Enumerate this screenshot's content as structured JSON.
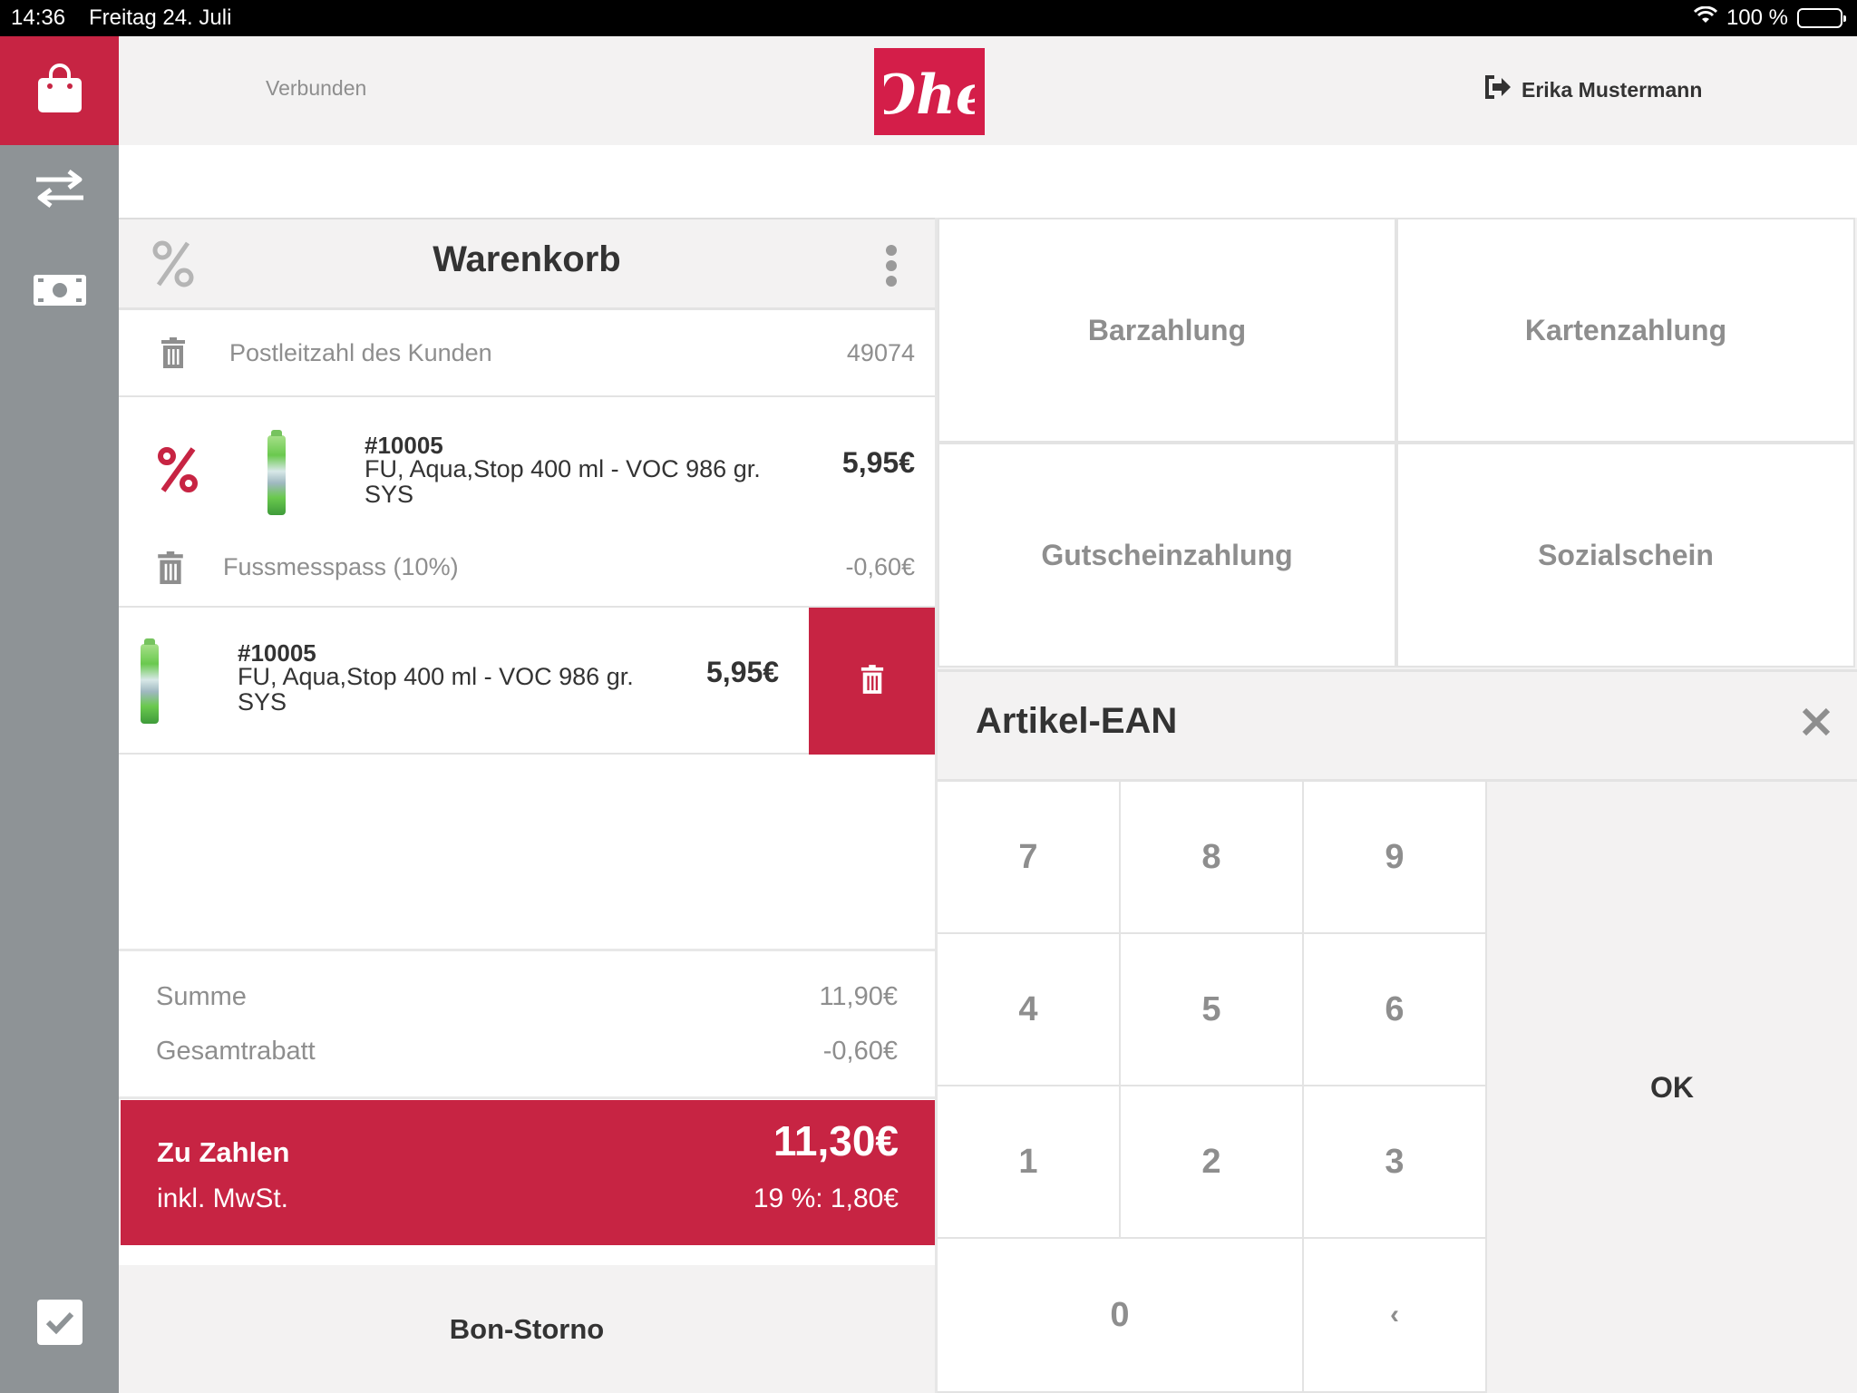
{
  "status": {
    "time": "14:36",
    "date": "Freitag 24. Juli",
    "battery": "100 %"
  },
  "sidebar": {
    "items": [
      {
        "name": "shop",
        "icon": "shopping-bag-icon"
      },
      {
        "name": "transfer",
        "icon": "arrows-exchange-icon"
      },
      {
        "name": "cash",
        "icon": "banknote-icon"
      },
      {
        "name": "confirm",
        "icon": "checkbox-icon"
      }
    ]
  },
  "header": {
    "connection": "Verbunden",
    "logo_text": "Ohe",
    "user": "Erika Mustermann"
  },
  "cart": {
    "title": "Warenkorb",
    "postal": {
      "label": "Postleitzahl des Kunden",
      "value": "49074"
    },
    "items": [
      {
        "number": "#10005",
        "name": "FU, Aqua,Stop 400 ml - VOC 986 gr. SYS",
        "price": "5,95€",
        "discount": {
          "label": "Fussmesspass (10%)",
          "value": "-0,60€"
        }
      },
      {
        "number": "#10005",
        "name": "FU, Aqua,Stop 400 ml - VOC 986 gr. SYS",
        "price": "5,95€"
      }
    ],
    "totals": {
      "sum_label": "Summe",
      "sum_value": "11,90€",
      "discount_label": "Gesamtrabatt",
      "discount_value": "-0,60€"
    },
    "pay": {
      "label": "Zu Zahlen",
      "value": "11,30€",
      "tax_label": "inkl. MwSt.",
      "tax_value": "19 %: 1,80€"
    },
    "storno": "Bon-Storno"
  },
  "payment": {
    "cash": "Barzahlung",
    "card": "Kartenzahlung",
    "voucher": "Gutscheinzahlung",
    "social": "Sozialschein"
  },
  "ean": {
    "title": "Artikel-EAN",
    "keys": [
      "7",
      "8",
      "9",
      "4",
      "5",
      "6",
      "1",
      "2",
      "3",
      "0",
      "‹"
    ],
    "ok": "OK"
  },
  "colors": {
    "accent": "#c72443",
    "sidebar": "#8e9396",
    "background": "#f3f2f2",
    "logo": "#d41e49"
  }
}
